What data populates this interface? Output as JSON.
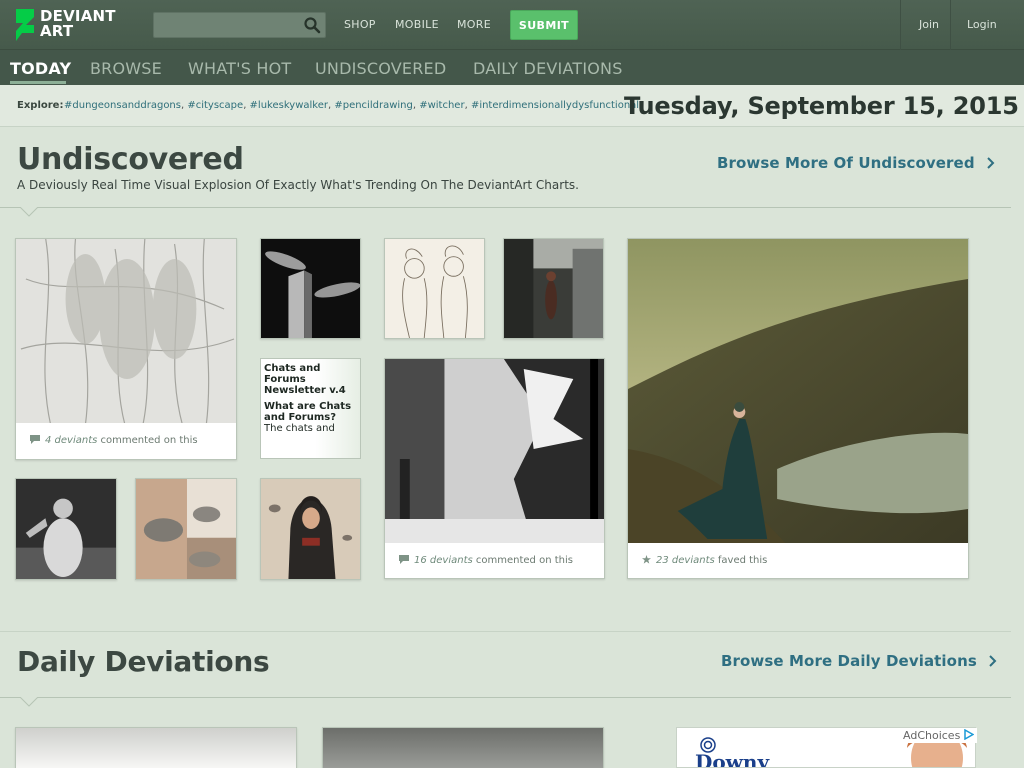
{
  "header": {
    "logo_line1": "DEVIANT",
    "logo_line2": "ART",
    "search_placeholder": "",
    "nav": [
      "SHOP",
      "MOBILE",
      "MORE"
    ],
    "submit": "SUBMIT",
    "join": "Join",
    "login": "Login"
  },
  "subnav": {
    "items": [
      "TODAY",
      "BROWSE",
      "WHAT'S HOT",
      "UNDISCOVERED",
      "DAILY DEVIATIONS"
    ],
    "active": "TODAY"
  },
  "explore": {
    "label": "Explore:",
    "tags": [
      "#dungeonsanddragons",
      "#cityscape",
      "#lukeskywalker",
      "#pencildrawing",
      "#witcher",
      "#interdimensionallydysfunctional"
    ],
    "date": "Tuesday, September 15, 2015"
  },
  "undiscovered": {
    "title": "Undiscovered",
    "subtitle": "A Deviously Real Time Visual Explosion Of Exactly What's Trending On The DeviantArt Charts.",
    "more": "Browse More Of Undiscovered",
    "thumb1_count": "4 deviants",
    "thumb1_text": " commented on this",
    "thumb_tower_count": "16 deviants",
    "thumb_tower_text": " commented on this",
    "thumb_lake_count": "23 deviants",
    "thumb_lake_text": " faved this",
    "lit_title": "Chats and Forums Newsletter v.4",
    "lit_sub": "What are Chats and Forums?",
    "lit_body": "The chats and"
  },
  "daily": {
    "title": "Daily Deviations",
    "more": "Browse More Daily Deviations"
  },
  "ad": {
    "choices": "AdChoices",
    "brand": "Downy"
  },
  "colors": {
    "header_bg": "#4a5d4f",
    "submit_green": "#5ac06c",
    "link_blue": "#2f6f82",
    "page_bg": "#dae4d8"
  }
}
